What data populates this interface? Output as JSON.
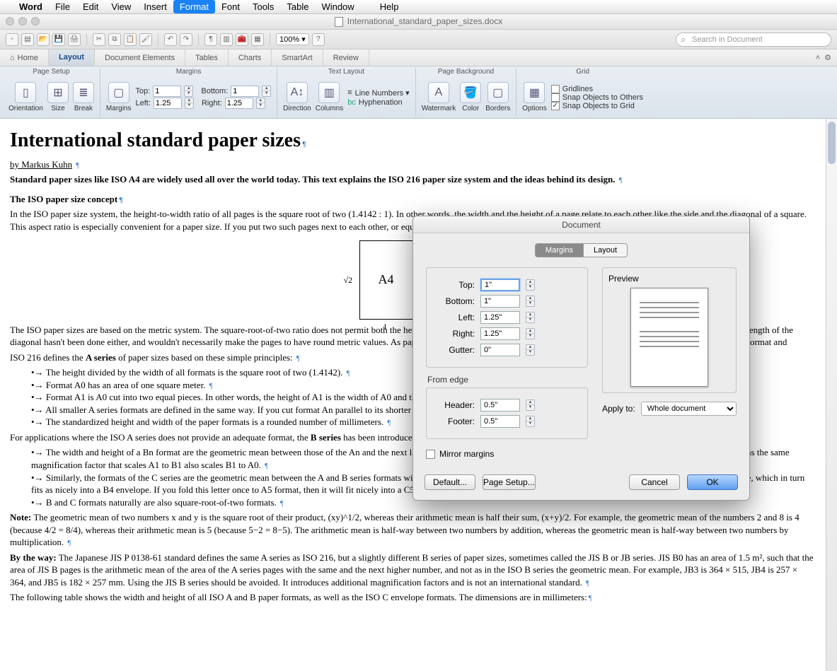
{
  "menubar": {
    "apple": "",
    "items": [
      "Word",
      "File",
      "Edit",
      "View",
      "Insert",
      "Format",
      "Font",
      "Tools",
      "Table",
      "Window",
      "",
      "Help"
    ],
    "active_index": 5
  },
  "window": {
    "filename": "International_standard_paper_sizes.docx"
  },
  "qa": {
    "zoom": "100%",
    "search_placeholder": "Search in Document"
  },
  "rtabs": {
    "home_icon": "⌂",
    "items": [
      "Home",
      "Layout",
      "Document Elements",
      "Tables",
      "Charts",
      "SmartArt",
      "Review"
    ],
    "active_index": 1
  },
  "ribbon": {
    "groups": {
      "page_setup": {
        "title": "Page Setup",
        "orientation": "Orientation",
        "size": "Size",
        "break": "Break"
      },
      "margins": {
        "title": "Margins",
        "btn": "Margins",
        "top_lbl": "Top:",
        "top": "1",
        "bottom_lbl": "Bottom:",
        "bottom": "1",
        "left_lbl": "Left:",
        "left": "1.25",
        "right_lbl": "Right:",
        "right": "1.25"
      },
      "text_layout": {
        "title": "Text Layout",
        "direction": "Direction",
        "columns": "Columns",
        "line_numbers": "Line Numbers",
        "hyphenation": "Hyphenation"
      },
      "page_bg": {
        "title": "Page Background",
        "watermark": "Watermark",
        "color": "Color",
        "borders": "Borders"
      },
      "grid": {
        "title": "Grid",
        "options": "Options",
        "gridlines": "Gridlines",
        "snap_others": "Snap Objects to Others",
        "snap_grid": "Snap Objects to Grid"
      }
    }
  },
  "doc": {
    "h1": "International standard paper sizes",
    "byline": "by Markus Kuhn",
    "p1": "Standard paper sizes like ISO A4 are widely used all over the world today. This text explains the ISO 216 paper size system and the ideas behind its design.",
    "h2": "The ISO paper size concept",
    "p2": "In the ISO paper size system, the height-to-width ratio of all pages is the square root of two (1.4142 : 1). In other words, the width and the height of a page relate to each other like the side and the diagonal of a square. This aspect ratio is especially convenient for a paper size. If you put two such pages next to each other, or equivalently cut one parallel to its",
    "diagram": {
      "root2": "√2",
      "a4": "A4",
      "one": "1",
      "bottom": "1 : √2"
    },
    "p3": "The ISO paper sizes are based on the metric system. The square-root-of-two ratio does not permit both the height and width of the pages to be nicely rounded metric lengths. Being based on a rounded length of the diagonal hasn't been done either, and wouldn't necessarily make the pages to have round metric values. As paper is usually specified in g/m², this simplifies calculation of the mass of a document if the format and",
    "p4_pre": "ISO 216 defines the ",
    "p4_b": "A series",
    "p4_post": " of paper sizes based on these simple principles:",
    "list1": [
      "The height divided by the width of all formats is the square root of two (1.4142).",
      "Format A0 has an area of one square meter.",
      "Format A1 is A0 cut into two equal pieces. In other words, the height of A1 is the width of A0 and the width of",
      "All smaller A series formats are defined in the same way. If you cut format An parallel to its shorter side into two",
      "The standardized height and width of the paper formats is a rounded number of millimeters."
    ],
    "p5_pre": "For applications where the ISO A series does not provide an adequate format, the ",
    "p5_b": "B series",
    "p5_post": " has been introduced to cover",
    "list2": [
      "The width and height of a Bn format are the geometric mean between those of the An and the next larger A(n−1) format. For example, B1 is the geometric mean between A1 and A0, that means the same magnification factor that scales A1 to B1 also scales B1 to A0.",
      "Similarly, the formats of the C series are the geometric mean between the A and B series formats with the same number. For example, an (unfolded) A4 size letter fits nicely into a C4 envelope, which in turn fits as nicely into a B4 envelope. If you fold this letter once to A5 format, then it will fit nicely into a C5 envelope.",
      "B and C formats naturally are also square-root-of-two formats."
    ],
    "note_b": "Note:",
    "note": " The geometric mean of two numbers x and y is the square root of their product, (xy)^1/2, whereas their arithmetic mean is half their sum, (x+y)/2. For example, the geometric mean of the numbers 2 and 8 is 4 (because 4/2 = 8/4), whereas their arithmetic mean is 5 (because 5−2 = 8−5). The arithmetic mean is half-way between two numbers by addition, whereas the geometric mean is half-way between two numbers by multiplication.",
    "btw_b": "By the way:",
    "btw": " The Japanese JIS P 0138-61 standard defines the same A series as ISO 216, but a slightly different B series of paper sizes, sometimes called the JIS B or JB series. JIS B0 has an area of 1.5 m², such that the area of JIS B pages is the arithmetic mean of the area of the A series pages with the same and the next higher number, and not as in the ISO B series the geometric mean. For example, JB3 is 364 × 515, JB4 is 257 × 364, and JB5 is 182 × 257 mm. Using the JIS B series should be avoided. It introduces additional magnification factors and is not an international standard.",
    "p8": "The following table shows the width and height of all ISO A and B paper formats, as well as the ISO C envelope formats. The dimensions are in millimeters:"
  },
  "dialog": {
    "title": "Document",
    "tabs": [
      "Margins",
      "Layout"
    ],
    "active_tab": 0,
    "margins": {
      "top_lbl": "Top:",
      "top": "1\"",
      "bottom_lbl": "Bottom:",
      "bottom": "1\"",
      "left_lbl": "Left:",
      "left": "1.25\"",
      "right_lbl": "Right:",
      "right": "1.25\"",
      "gutter_lbl": "Gutter:",
      "gutter": "0\""
    },
    "from_edge": {
      "title": "From edge",
      "header_lbl": "Header:",
      "header": "0.5\"",
      "footer_lbl": "Footer:",
      "footer": "0.5\""
    },
    "preview_lbl": "Preview",
    "apply_lbl": "Apply to:",
    "apply_value": "Whole document",
    "mirror": "Mirror margins",
    "btn_default": "Default...",
    "btn_pagesetup": "Page Setup...",
    "btn_cancel": "Cancel",
    "btn_ok": "OK"
  }
}
